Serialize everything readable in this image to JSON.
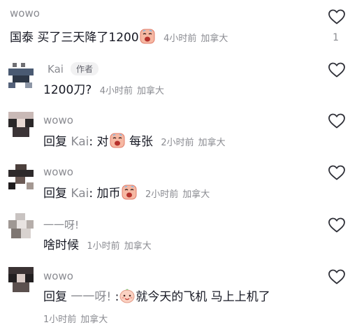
{
  "comments": [
    {
      "username": "wowo",
      "text": "国泰 买了三天降了1200",
      "emoji": "crying-face-emoji",
      "time": "4小时前",
      "location": "加拿大",
      "likes": "1"
    },
    {
      "username": "Kai",
      "badge": "作者",
      "text": "1200刀?",
      "time": "4小时前",
      "location": "加拿大"
    },
    {
      "username": "wowo",
      "reply_prefix": "回复",
      "reply_target": "Kai",
      "text_before": ": 对",
      "emoji": "crying-face-emoji",
      "text_after": "每张",
      "time": "2小时前",
      "location": "加拿大"
    },
    {
      "username": "wowo",
      "reply_prefix": "回复",
      "reply_target": "Kai",
      "text_before": ": 加币",
      "emoji": "crying-face-emoji",
      "time": "2小时前",
      "location": "加拿大"
    },
    {
      "username": "一一呀!",
      "text": "啥时候",
      "time": "1小时前",
      "location": "加拿大"
    },
    {
      "username": "wowo",
      "reply_prefix": "回复",
      "reply_target": "一一呀!",
      "text_before": ":",
      "emoji": "smiling-face-emoji",
      "text_after": "就今天的飞机 马上上机了",
      "time": "1小时前",
      "location": "加拿大"
    }
  ],
  "colors": {
    "text": "#161823",
    "muted": "#8a8b91",
    "badge_bg": "#f1f1f2"
  }
}
